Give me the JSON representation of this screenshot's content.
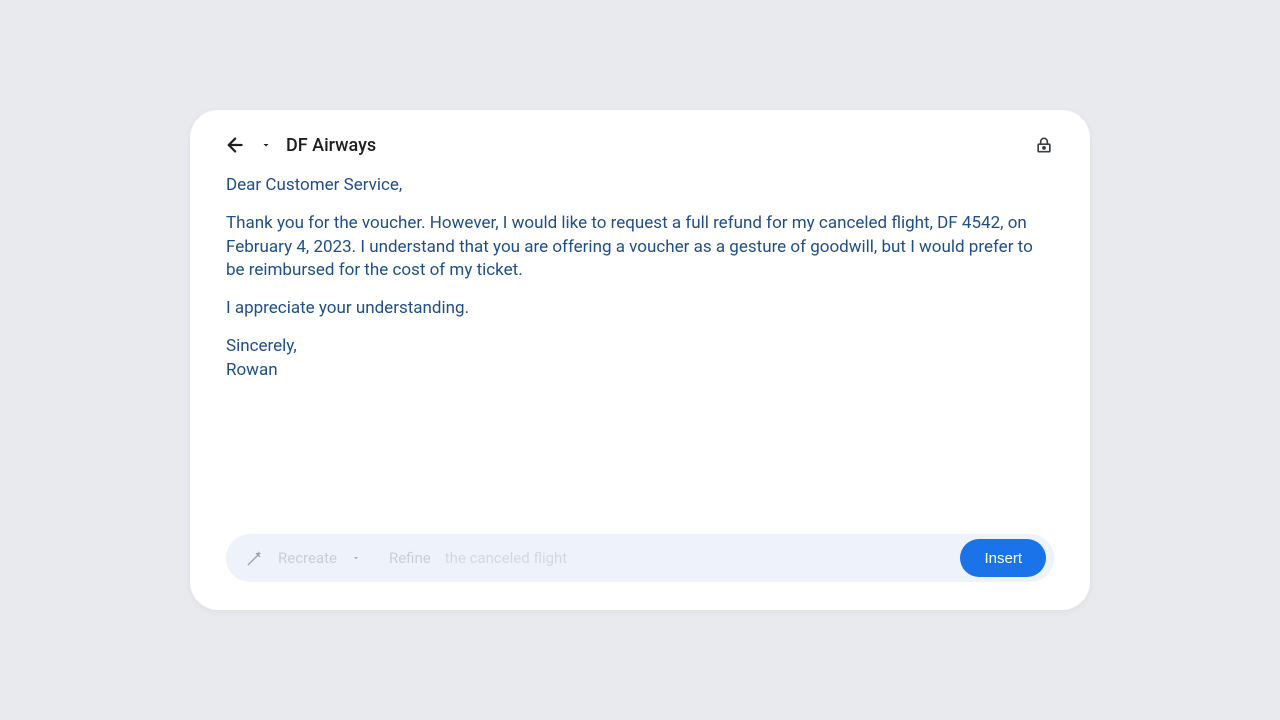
{
  "header": {
    "title": "DF Airways"
  },
  "body": {
    "greeting": "Dear Customer Service,",
    "para1": "Thank you for the voucher. However, I would like to request a full refund for my canceled flight, DF 4542, on February 4, 2023. I understand that you are offering a voucher as a gesture of goodwill, but I would prefer to be reimbursed for the cost of my ticket.",
    "para2": "I appreciate your understanding.",
    "signoff": "Sincerely,",
    "name": "Rowan"
  },
  "bottomBar": {
    "option1": "Recreate",
    "option2": "Refine",
    "hint": "the canceled flight",
    "insertLabel": "Insert"
  }
}
